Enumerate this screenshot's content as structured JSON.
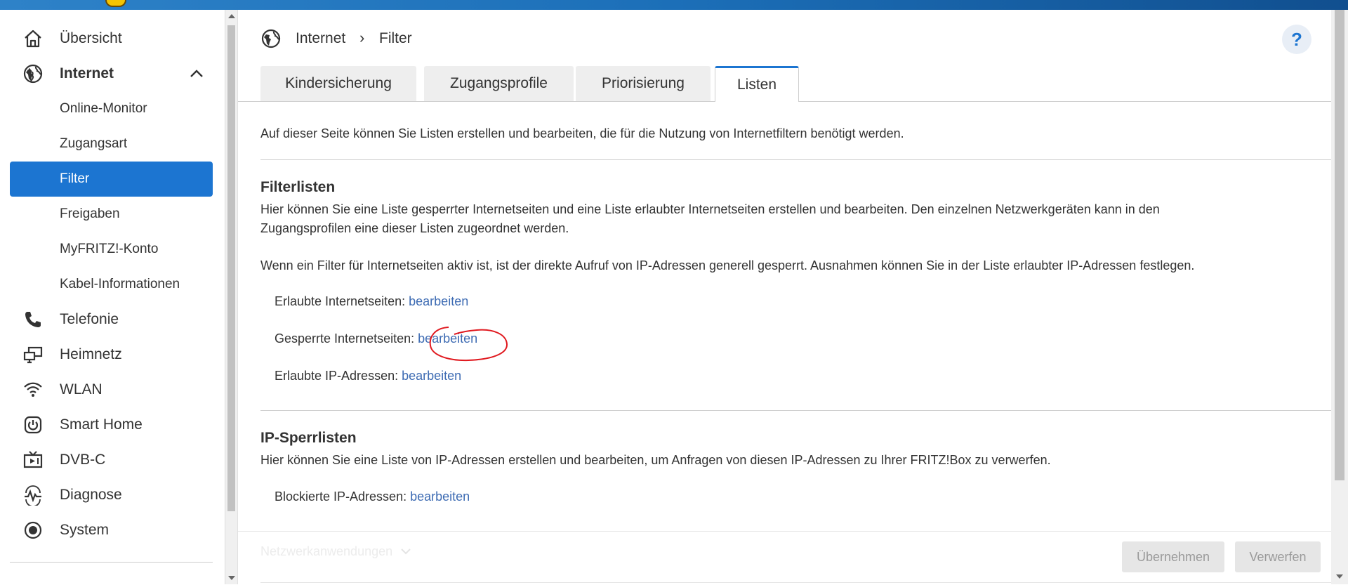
{
  "sidebar": {
    "items": [
      {
        "label": "Übersicht",
        "icon": "home-icon"
      },
      {
        "label": "Internet",
        "icon": "globe-icon"
      },
      {
        "label": "Telefonie",
        "icon": "phone-icon"
      },
      {
        "label": "Heimnetz",
        "icon": "network-icon"
      },
      {
        "label": "WLAN",
        "icon": "wifi-icon"
      },
      {
        "label": "Smart Home",
        "icon": "power-icon"
      },
      {
        "label": "DVB-C",
        "icon": "tv-icon"
      },
      {
        "label": "Diagnose",
        "icon": "diagnosis-icon"
      },
      {
        "label": "System",
        "icon": "system-icon"
      }
    ],
    "internet_sub": [
      {
        "label": "Online-Monitor"
      },
      {
        "label": "Zugangsart"
      },
      {
        "label": "Filter"
      },
      {
        "label": "Freigaben"
      },
      {
        "label": "MyFRITZ!-Konto"
      },
      {
        "label": "Kabel-Informationen"
      }
    ]
  },
  "breadcrumb": {
    "root": "Internet",
    "separator": "›",
    "current": "Filter"
  },
  "help": {
    "label": "?"
  },
  "tabs": [
    {
      "label": "Kindersicherung"
    },
    {
      "label": "Zugangsprofile"
    },
    {
      "label": "Priorisierung"
    },
    {
      "label": "Listen"
    }
  ],
  "intro": "Auf dieser Seite können Sie Listen erstellen und bearbeiten, die für die Nutzung von Internetfiltern benötigt werden.",
  "filterlisten": {
    "title": "Filterlisten",
    "desc_line1": "Hier können Sie eine Liste gesperrter Internetseiten und eine Liste erlaubter Internetseiten erstellen und bearbeiten. Den einzelnen Netzwerkgeräten kann in den",
    "desc_line2": "Zugangsprofilen eine dieser Listen zugeordnet werden.",
    "note": "Wenn ein Filter für Internetseiten aktiv ist, ist der direkte Aufruf von IP-Adressen generell gesperrt. Ausnahmen können Sie in der Liste erlaubter IP-Adressen festlegen.",
    "rows": [
      {
        "label": "Erlaubte Internetseiten:",
        "link": "bearbeiten"
      },
      {
        "label": "Gesperrte Internetseiten:",
        "link": "bearbeiten"
      },
      {
        "label": "Erlaubte IP-Adressen:",
        "link": "bearbeiten"
      }
    ]
  },
  "ipsperr": {
    "title": "IP-Sperrlisten",
    "desc": "Hier können Sie eine Liste von IP-Adressen erstellen und bearbeiten, um Anfragen von diesen IP-Adressen zu Ihrer FRITZ!Box zu verwerfen.",
    "rows": [
      {
        "label": "Blockierte IP-Adressen:",
        "link": "bearbeiten"
      }
    ]
  },
  "footer": {
    "faded_label": "Netzwerkanwendungen",
    "apply_label": "Übernehmen",
    "discard_label": "Verwerfen"
  },
  "colors": {
    "accent": "#1c75d1",
    "link": "#3d6bb3",
    "annotation": "#e0191f"
  }
}
